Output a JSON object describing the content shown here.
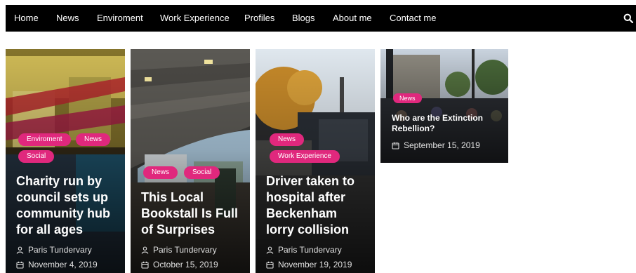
{
  "colors": {
    "nav_bg": "#000000",
    "tag_bg": "#e0287d",
    "text": "#ffffff"
  },
  "nav": {
    "items": [
      "Home",
      "News",
      "Enviroment",
      "Work Experience",
      "Profiles",
      "Blogs",
      "About me",
      "Contact me"
    ],
    "search_icon": "search-icon"
  },
  "cards": [
    {
      "tags": [
        "Enviroment",
        "News",
        "Social"
      ],
      "title_lines": [
        "Charity run by",
        "council sets up",
        "community hub",
        "for all ages"
      ],
      "author": "Paris Tundervary",
      "date": "November 4, 2019"
    },
    {
      "tags": [
        "News",
        "Social"
      ],
      "title_lines": [
        "This Local",
        "Bookstall Is Full",
        "of Surprises"
      ],
      "author": "Paris Tundervary",
      "date": "October 15, 2019"
    },
    {
      "tags": [
        "News",
        "Work Experience"
      ],
      "title_lines": [
        "Driver taken to",
        "hospital after",
        "Beckenham",
        "lorry collision"
      ],
      "author": "Paris Tundervary",
      "date": "November 19, 2019"
    },
    {
      "tags": [
        "News"
      ],
      "title_lines": [
        "Who are the Extinction",
        "Rebellion?"
      ],
      "date": "September 15, 2019"
    }
  ],
  "icons": {
    "author": "user-icon",
    "date": "calendar-icon"
  }
}
